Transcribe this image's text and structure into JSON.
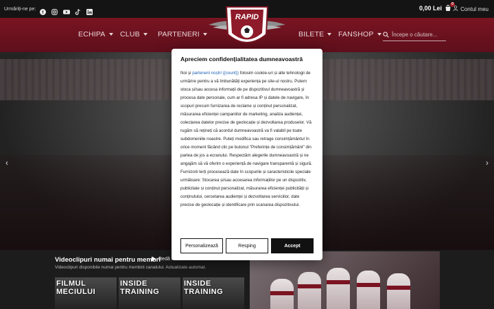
{
  "topbar": {
    "follow_label": "Urmăriți-ne pe:",
    "social_icons": [
      "facebook-icon",
      "instagram-icon",
      "youtube-icon",
      "tiktok-icon",
      "linkedin-icon"
    ],
    "cart_total": "0,00 Lei",
    "cart_count": "0",
    "account_label": "Contul meu"
  },
  "logo": {
    "text": "RAPID"
  },
  "nav": {
    "items_left": [
      {
        "label": "ECHIPA"
      },
      {
        "label": "CLUB"
      },
      {
        "label": "PARTENERI"
      }
    ],
    "items_right": [
      {
        "label": "BILETE"
      },
      {
        "label": "FANSHOP"
      }
    ],
    "search_placeholder": "Începe o căutare..."
  },
  "hero": {
    "arrows": [
      "‹",
      "›"
    ]
  },
  "videos": {
    "title": "Videoclipuri numai pentru membri",
    "play_label": "Redă tot",
    "subtitle": "Videoclipuri disponibile numai pentru membrii canalului. Actualizate automat.",
    "thumbs": [
      "FILMUL MECIULUI",
      "INSIDE TRAINING",
      "INSIDE TRAINING"
    ]
  },
  "cookie_modal": {
    "title": "Apreciem confidențialitatea dumneavoastră",
    "text_before_link": "Noi și ",
    "link_text": "partenerii noștri ({count})",
    "text_after_link": " folosim cookie-uri și alte tehnologii de urmărire pentru a vă îmbunătăți experiența pe site-ul nostru. Putem stoca și/sau accesa informații de pe dispozitivul dumneavoastră și procesa date personale, cum ar fi adresa IP și datele de navigare, în scopuri precum furnizarea de reclame și conținut personalizat, măsurarea eficienței campaniilor de marketing, analiza audienței, colectarea datelor precise de geolocație și dezvoltarea produselor. Vă rugăm să rețineți că acordul dumneavoastră va fi valabil pe toate subdomeniile noastre. Puteți modifica sau retrage consimțământul în orice moment făcând clic pe butonul \"Preferințe de consimțământ\" din partea de jos a ecranului. Respectăm alegerile dumneavoastră și ne angajăm să vă oferim o experiență de navigare transparentă și sigură. Furnizorii terți procesează date în scopurile și caracteristicile speciale următoare: Stocarea și/sau accesarea informațiilor pe un dispozitiv, publicitate și conținut personalizat, măsurarea eficienței publicității și conținutului, cercetarea audienței și dezvoltarea serviciilor, date precise de geolocație și identificare prin scanarea dispozitivului.",
    "buttons": {
      "customize": "Personalizează",
      "reject": "Resping",
      "accept": "Accept"
    }
  }
}
